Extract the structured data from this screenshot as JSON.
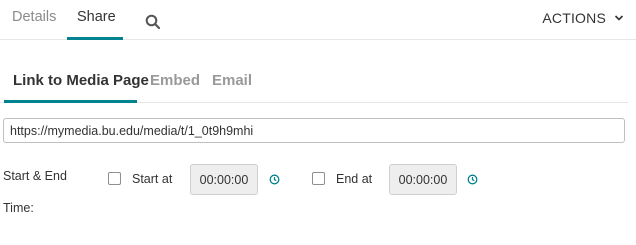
{
  "top_tabs": [
    {
      "label": "Details",
      "active": false
    },
    {
      "label": "Share",
      "active": true
    }
  ],
  "header": {
    "search_icon": "search-icon",
    "actions_label": "ACTIONS",
    "actions_icon": "chevron-down-icon"
  },
  "share_tabs": [
    {
      "label": "Link to Media Page",
      "active": true
    },
    {
      "label": "Embed",
      "active": false
    },
    {
      "label": "Email",
      "active": false
    }
  ],
  "link": {
    "value": "https://mymedia.bu.edu/media/t/1_0t9h9mhi"
  },
  "time_range": {
    "label_line1": "Start & End",
    "label_line2": "Time:",
    "start": {
      "label": "Start at",
      "value": "00:00:00",
      "checked": false,
      "icon": "clock-icon"
    },
    "end": {
      "label": "End at",
      "value": "00:00:00",
      "checked": false,
      "icon": "clock-icon"
    }
  },
  "colors": {
    "accent": "#00838f",
    "tab_inactive": "#999999",
    "text": "#333333"
  }
}
